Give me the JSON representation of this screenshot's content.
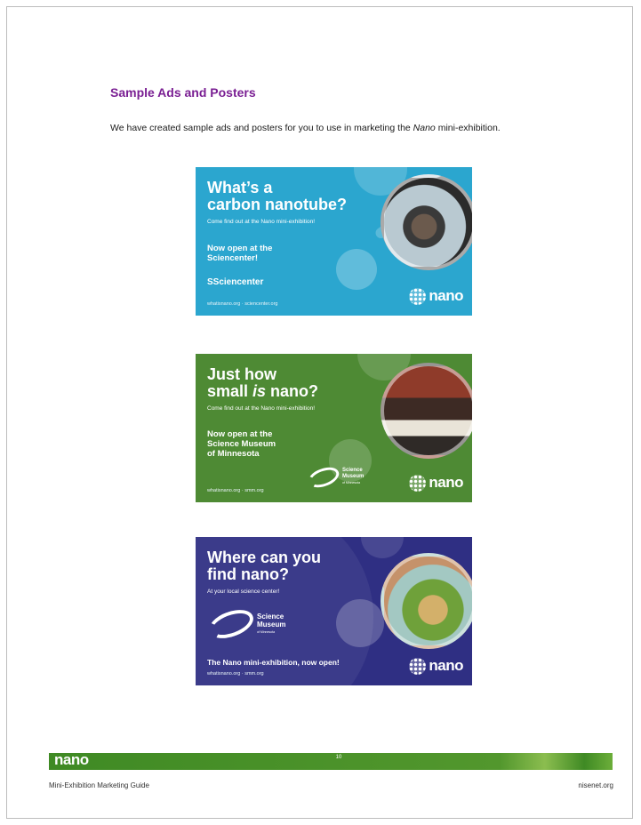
{
  "heading": "Sample Ads and Posters",
  "intro": {
    "before": "We have created sample ads and posters for you to use in marketing the ",
    "emphasis": "Nano",
    "after": " mini-exhibition."
  },
  "ads": [
    {
      "title_line1": "What’s a",
      "title_line2": "carbon nanotube?",
      "subtitle": "Come find out at the Nano mini-exhibition!",
      "open_line1": "Now open at the",
      "open_line2": "Sciencenter!",
      "sponsor": "Sciencenter",
      "url": "whatisnano.org · sciencenter.org",
      "logo": "nano",
      "color": "#2ba6cf"
    },
    {
      "title_line1": "Just how",
      "title_pre": "small ",
      "title_em": "is",
      "title_post": " nano?",
      "subtitle": "Come find out at the Nano mini-exhibition!",
      "open_line1": "Now open at the",
      "open_line2": "Science Museum",
      "open_line3": "of Minnesota",
      "sponsor_line1": "Science",
      "sponsor_line2": "Museum",
      "sponsor_line3": "of Minnesota",
      "url": "whatisnano.org · smm.org",
      "logo": "nano",
      "color": "#4e8a34"
    },
    {
      "title_line1": "Where can you",
      "title_line2": "find nano?",
      "subtitle": "At your local science center!",
      "sponsor_line1": "Science",
      "sponsor_line2": "Museum",
      "sponsor_line3": "of Minnesota",
      "tagline": "The Nano mini-exhibition, now open!",
      "url": "whatisnano.org · smm.org",
      "logo": "nano",
      "color": "#2f2f83"
    }
  ],
  "footer": {
    "logo": "nano",
    "page_number": "10",
    "left": "Mini-Exhibition Marketing Guide",
    "right": "nisenet.org",
    "bar_color": "#4a9a2a"
  }
}
